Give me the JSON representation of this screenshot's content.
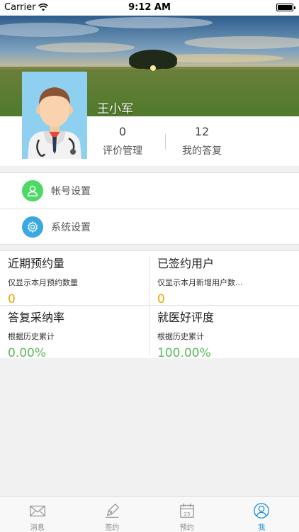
{
  "status_bar": {
    "carrier": "Carrier",
    "time": "9:12 AM"
  },
  "profile": {
    "name": "王小军"
  },
  "counts": {
    "evaluation": {
      "value": "0",
      "label": "评价管理"
    },
    "replies": {
      "value": "12",
      "label": "我的答复"
    }
  },
  "settings": {
    "account": {
      "label": "帐号设置",
      "icon": "user-icon"
    },
    "system": {
      "label": "系统设置",
      "icon": "gear-icon"
    }
  },
  "stats": {
    "recent_appointments": {
      "title": "近期预约量",
      "desc": "仅显示本月预约数量",
      "value": "0"
    },
    "signed_users": {
      "title": "已签约用户",
      "desc": "仅显示本月新增用户数...",
      "value": "0"
    },
    "adoption_rate": {
      "title": "答复采纳率",
      "desc": "根据历史累计",
      "value": "0.00%"
    },
    "satisfaction": {
      "title": "就医好评度",
      "desc": "根据历史累计",
      "value": "100.00%"
    }
  },
  "tabbar": {
    "messages": {
      "label": "消息",
      "icon": "envelope-icon"
    },
    "sign": {
      "label": "签约",
      "icon": "pen-icon"
    },
    "appointment": {
      "label": "预约",
      "icon": "calendar-icon",
      "day": "25"
    },
    "me": {
      "label": "我",
      "icon": "person-icon",
      "active": true
    }
  },
  "colors": {
    "accent": "#1a8cd8",
    "orange_value": "#f0a400",
    "green_value": "#5cb85c"
  }
}
